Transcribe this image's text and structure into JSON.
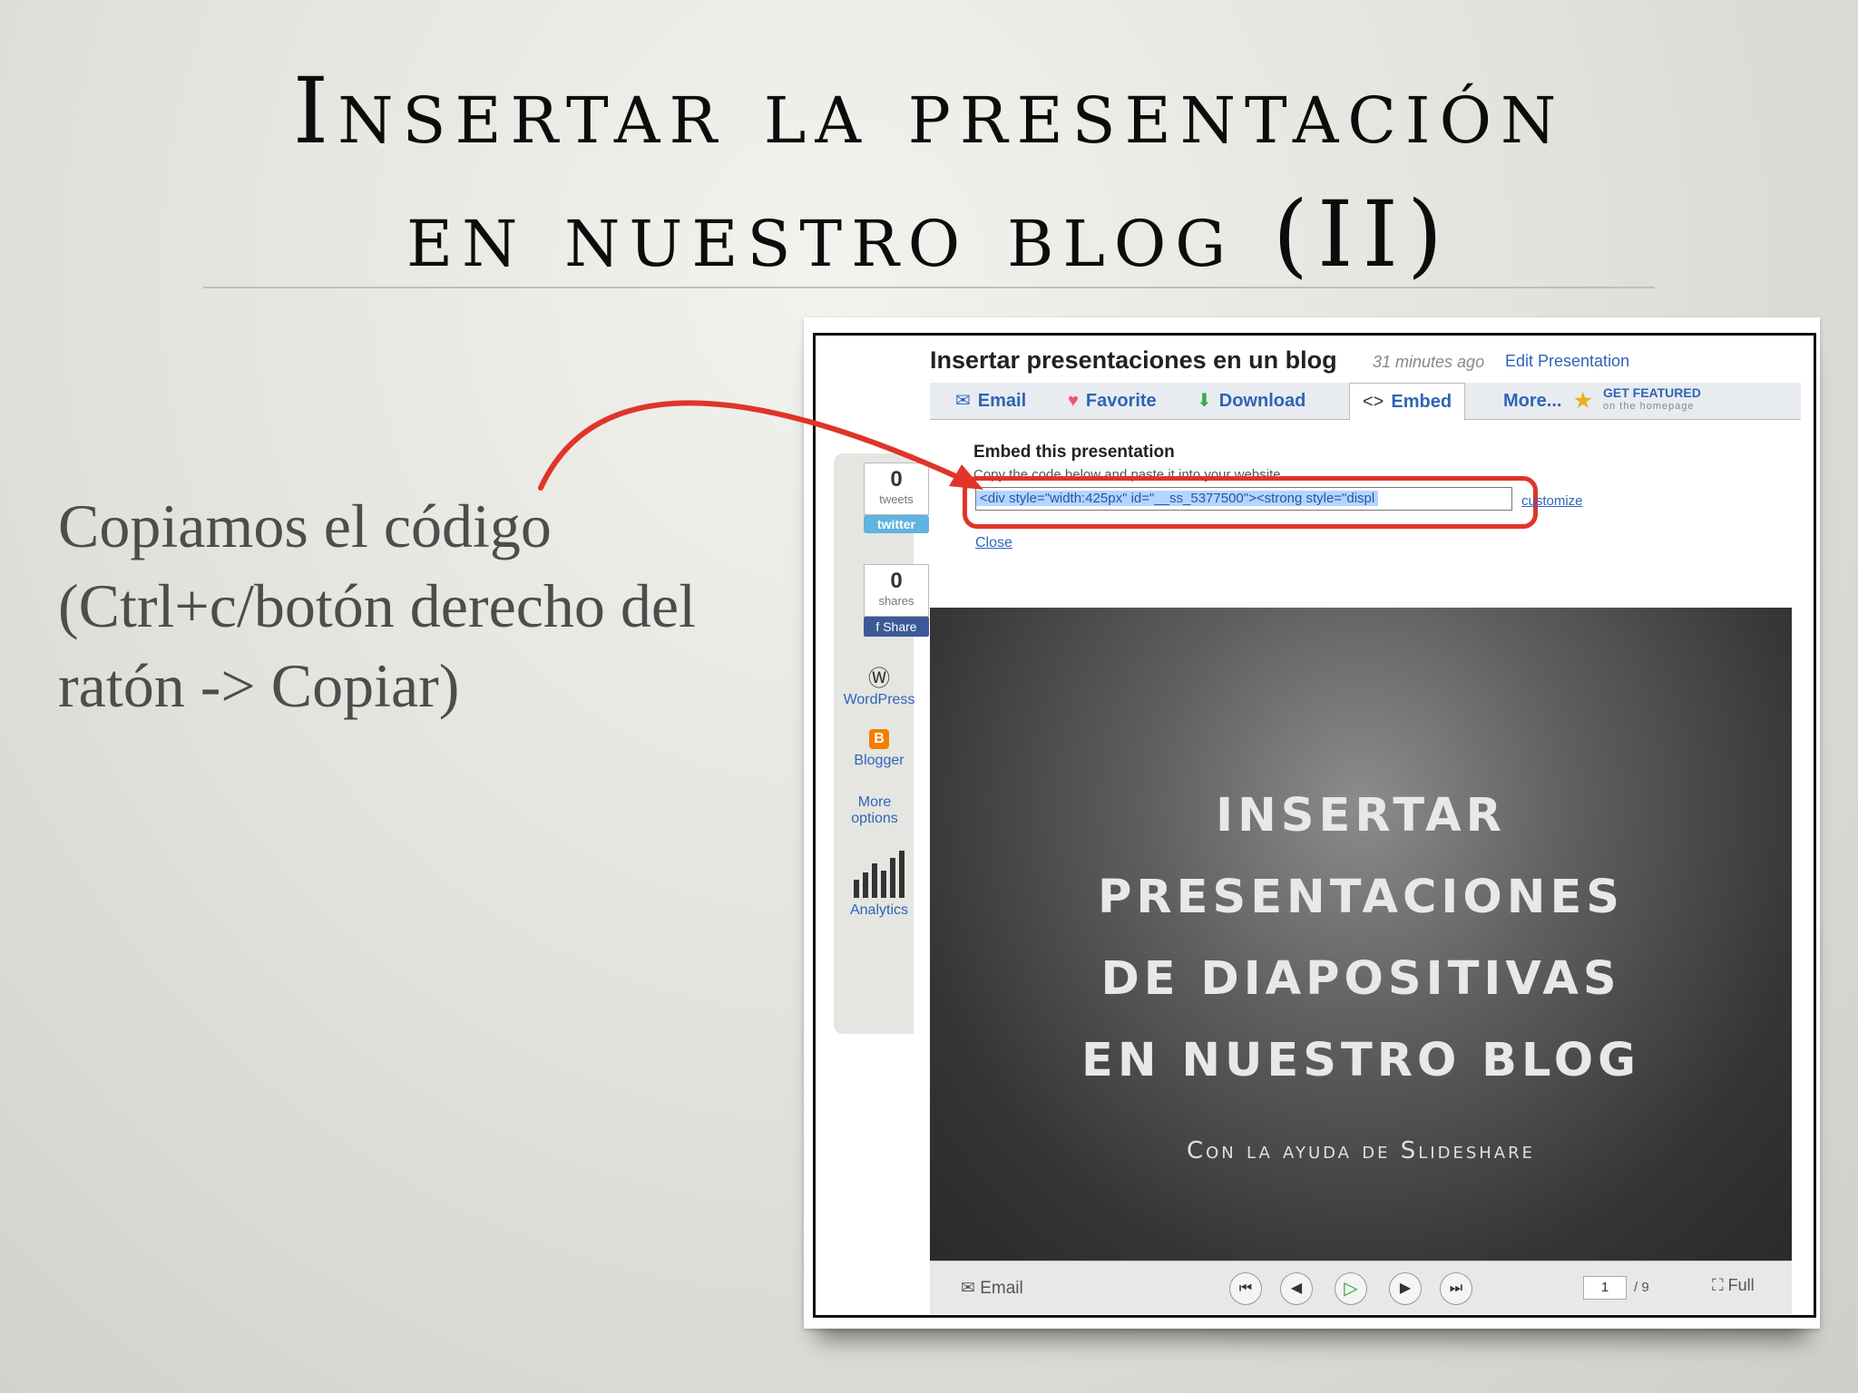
{
  "slide": {
    "title_line1": "Insertar la presentación",
    "title_line2": "en nuestro blog (II)",
    "body": [
      "Copiamos el código",
      "(Ctrl+c/botón derecho del",
      "ratón -> Copiar)"
    ]
  },
  "screenshot": {
    "presentation_title": "Insertar presentaciones en un blog",
    "time_ago": "31 minutes ago",
    "edit_link": "Edit Presentation",
    "tabs": [
      {
        "label": "Email",
        "icon": "envelope-icon"
      },
      {
        "label": "Favorite",
        "icon": "heart-icon"
      },
      {
        "label": "Download",
        "icon": "download-icon"
      },
      {
        "label": "Embed",
        "icon": "code-icon"
      },
      {
        "label": "More...",
        "icon": ""
      }
    ],
    "featured": {
      "label": "GET FEATURED",
      "sub": "on the homepage",
      "icon": "star-icon"
    },
    "embed": {
      "heading": "Embed this presentation",
      "instructions": "Copy the code below and paste it into your website",
      "code": "<div style=\"width:425px\" id=\"__ss_5377500\"><strong style=\"displ",
      "customize": "customize",
      "close": "Close"
    },
    "sidebar": {
      "tweets_count": "0",
      "tweets_label": "tweets",
      "twitter": "twitter",
      "shares_count": "0",
      "shares_label": "shares",
      "share": "Share",
      "wordpress": "WordPress",
      "blogger": "Blogger",
      "more_options": "More options",
      "analytics": "Analytics"
    },
    "player": {
      "lines": [
        "INSERTAR",
        "PRESENTACIONES",
        "DE DIAPOSITIVAS",
        "EN NUESTRO BLOG"
      ],
      "subtitle": "Con la ayuda de Slideshare"
    },
    "controls": {
      "email": "Email",
      "page": "1",
      "total": "/ 9",
      "full": "Full"
    }
  },
  "colors": {
    "accent_red": "#e0342a",
    "link_blue": "#2f64b6"
  }
}
